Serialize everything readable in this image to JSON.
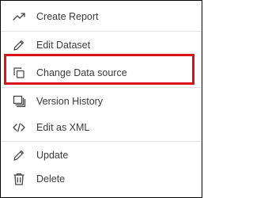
{
  "menu": {
    "items": [
      {
        "label": "Create Report",
        "icon": "trending-up-icon"
      },
      {
        "label": "Edit Dataset",
        "icon": "pencil-icon"
      },
      {
        "label": "Change Data source",
        "icon": "copy-icon"
      },
      {
        "label": "Version History",
        "icon": "stacked-pages-icon"
      },
      {
        "label": "Edit as XML",
        "icon": "code-icon"
      },
      {
        "label": "Update",
        "icon": "pencil-icon"
      },
      {
        "label": "Delete",
        "icon": "trash-icon"
      }
    ]
  },
  "colors": {
    "highlight_border": "#d9121b",
    "text": "#3a3a3a",
    "icon": "#444444",
    "divider": "#e3e3e3"
  }
}
